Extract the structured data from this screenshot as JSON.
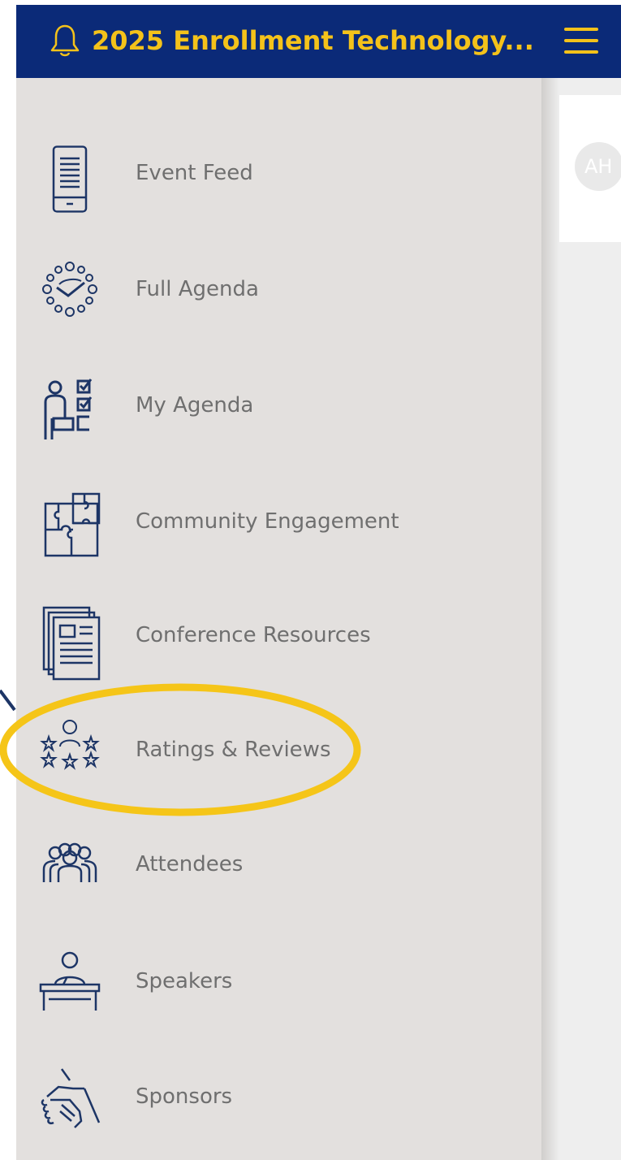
{
  "header": {
    "title": "2025 Enrollment Technology...",
    "bell_icon": "bell-icon",
    "menu_icon": "hamburger-menu-icon",
    "background": "#0b2a78",
    "accent": "#f4c21a"
  },
  "sidebar": {
    "background": "#e3e0de",
    "items": [
      {
        "label": "Event Feed",
        "icon": "tablet-feed-icon"
      },
      {
        "label": "Full Agenda",
        "icon": "clock-agenda-icon"
      },
      {
        "label": "My Agenda",
        "icon": "person-checklist-icon"
      },
      {
        "label": "Community Engagement",
        "icon": "puzzle-icon"
      },
      {
        "label": "Conference Resources",
        "icon": "documents-icon"
      },
      {
        "label": "Ratings & Reviews",
        "icon": "person-stars-icon"
      },
      {
        "label": "Attendees",
        "icon": "group-people-icon"
      },
      {
        "label": "Speakers",
        "icon": "speaker-podium-icon"
      },
      {
        "label": "Sponsors",
        "icon": "handshake-icon"
      }
    ],
    "highlighted_item": "Ratings & Reviews",
    "highlight_color": "#f5c518"
  },
  "content": {
    "avatar_initials": "AH"
  }
}
